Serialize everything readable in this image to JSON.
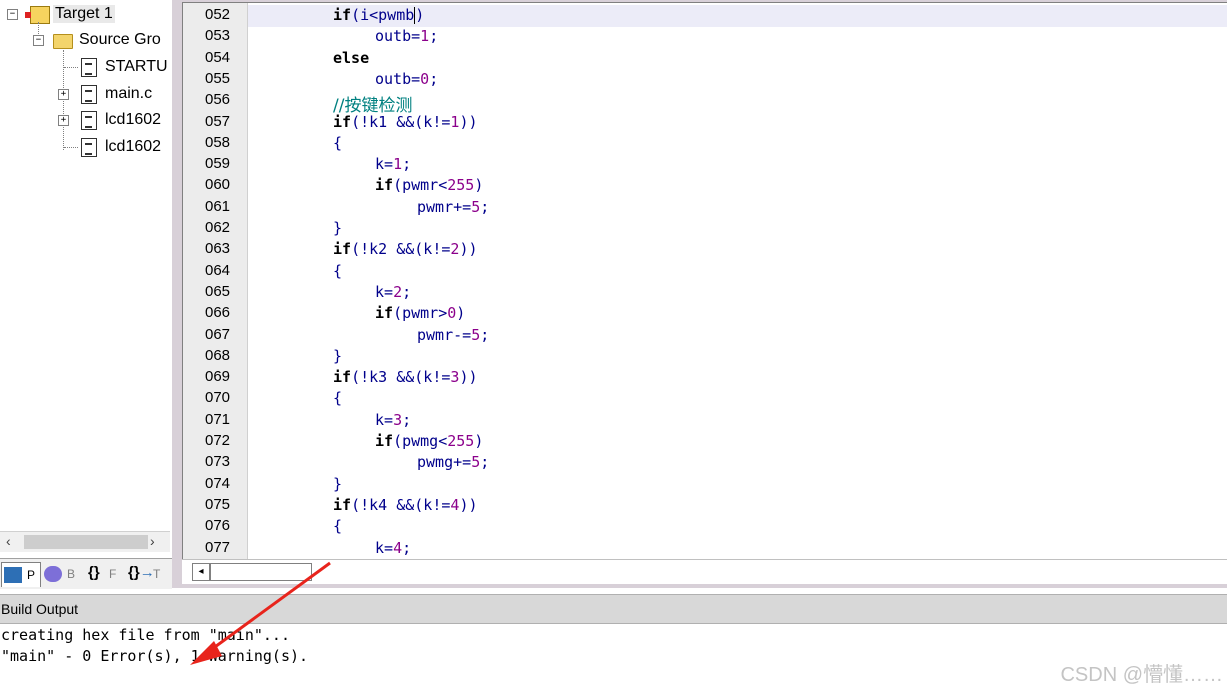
{
  "project": {
    "target_label": "Target 1",
    "group_label": "Source Gro",
    "files": [
      "STARTU",
      "main.c",
      "lcd1602",
      "lcd1602"
    ],
    "tabs": [
      "P",
      "B",
      "F",
      "T"
    ]
  },
  "editor": {
    "lines": [
      {
        "n": "052",
        "indent": 8
      },
      {
        "n": "053",
        "indent": 12
      },
      {
        "n": "054",
        "indent": 8
      },
      {
        "n": "055",
        "indent": 12
      },
      {
        "n": "056",
        "indent": 8
      },
      {
        "n": "057",
        "indent": 8
      },
      {
        "n": "058",
        "indent": 8
      },
      {
        "n": "059",
        "indent": 12
      },
      {
        "n": "060",
        "indent": 12
      },
      {
        "n": "061",
        "indent": 16
      },
      {
        "n": "062",
        "indent": 8
      },
      {
        "n": "063",
        "indent": 8
      },
      {
        "n": "064",
        "indent": 8
      },
      {
        "n": "065",
        "indent": 12
      },
      {
        "n": "066",
        "indent": 12
      },
      {
        "n": "067",
        "indent": 16
      },
      {
        "n": "068",
        "indent": 8
      },
      {
        "n": "069",
        "indent": 8
      },
      {
        "n": "070",
        "indent": 8
      },
      {
        "n": "071",
        "indent": 12
      },
      {
        "n": "072",
        "indent": 12
      },
      {
        "n": "073",
        "indent": 16
      },
      {
        "n": "074",
        "indent": 8
      },
      {
        "n": "075",
        "indent": 8
      },
      {
        "n": "076",
        "indent": 8
      },
      {
        "n": "077",
        "indent": 12
      }
    ],
    "code": [
      [
        [
          "kw",
          "if"
        ],
        [
          "txt",
          "(i<pwmb"
        ],
        [
          "caret",
          ""
        ],
        [
          "txt",
          ")"
        ]
      ],
      [
        [
          "txt",
          "outb="
        ],
        [
          "num",
          "1"
        ],
        [
          "txt",
          ";"
        ]
      ],
      [
        [
          "kw",
          "else"
        ]
      ],
      [
        [
          "txt",
          "outb="
        ],
        [
          "num",
          "0"
        ],
        [
          "txt",
          ";"
        ]
      ],
      [
        [
          "comment",
          "//按键检测"
        ]
      ],
      [
        [
          "kw",
          "if"
        ],
        [
          "txt",
          "(!k1 &&(k!="
        ],
        [
          "num",
          "1"
        ],
        [
          "txt",
          "))"
        ]
      ],
      [
        [
          "txt",
          "{"
        ]
      ],
      [
        [
          "txt",
          "k="
        ],
        [
          "num",
          "1"
        ],
        [
          "txt",
          ";"
        ]
      ],
      [
        [
          "kw",
          "if"
        ],
        [
          "txt",
          "(pwmr<"
        ],
        [
          "num",
          "255"
        ],
        [
          "txt",
          ")"
        ]
      ],
      [
        [
          "txt",
          "pwmr+="
        ],
        [
          "num",
          "5"
        ],
        [
          "txt",
          ";"
        ]
      ],
      [
        [
          "txt",
          "}"
        ]
      ],
      [
        [
          "kw",
          "if"
        ],
        [
          "txt",
          "(!k2 &&(k!="
        ],
        [
          "num",
          "2"
        ],
        [
          "txt",
          "))"
        ]
      ],
      [
        [
          "txt",
          "{"
        ]
      ],
      [
        [
          "txt",
          "k="
        ],
        [
          "num",
          "2"
        ],
        [
          "txt",
          ";"
        ]
      ],
      [
        [
          "kw",
          "if"
        ],
        [
          "txt",
          "(pwmr>"
        ],
        [
          "num",
          "0"
        ],
        [
          "txt",
          ")"
        ]
      ],
      [
        [
          "txt",
          "pwmr-="
        ],
        [
          "num",
          "5"
        ],
        [
          "txt",
          ";"
        ]
      ],
      [
        [
          "txt",
          "}"
        ]
      ],
      [
        [
          "kw",
          "if"
        ],
        [
          "txt",
          "(!k3 &&(k!="
        ],
        [
          "num",
          "3"
        ],
        [
          "txt",
          "))"
        ]
      ],
      [
        [
          "txt",
          "{"
        ]
      ],
      [
        [
          "txt",
          "k="
        ],
        [
          "num",
          "3"
        ],
        [
          "txt",
          ";"
        ]
      ],
      [
        [
          "kw",
          "if"
        ],
        [
          "txt",
          "(pwmg<"
        ],
        [
          "num",
          "255"
        ],
        [
          "txt",
          ")"
        ]
      ],
      [
        [
          "txt",
          "pwmg+="
        ],
        [
          "num",
          "5"
        ],
        [
          "txt",
          ";"
        ]
      ],
      [
        [
          "txt",
          "}"
        ]
      ],
      [
        [
          "kw",
          "if"
        ],
        [
          "txt",
          "(!k4 &&(k!="
        ],
        [
          "num",
          "4"
        ],
        [
          "txt",
          "))"
        ]
      ],
      [
        [
          "txt",
          "{"
        ]
      ],
      [
        [
          "txt",
          "k="
        ],
        [
          "num",
          "4"
        ],
        [
          "txt",
          ";"
        ]
      ]
    ]
  },
  "build_output": {
    "title": "Build Output",
    "lines": [
      "creating hex file from \"main\"...",
      "\"main\" - 0 Error(s), 1 Warning(s)."
    ]
  },
  "watermark": "CSDN @懵懂……",
  "colors": {
    "keyword": "#000000",
    "identifier": "#00008b",
    "number": "#8b008b",
    "comment": "#008080",
    "annotation_arrow": "#e8241c"
  }
}
